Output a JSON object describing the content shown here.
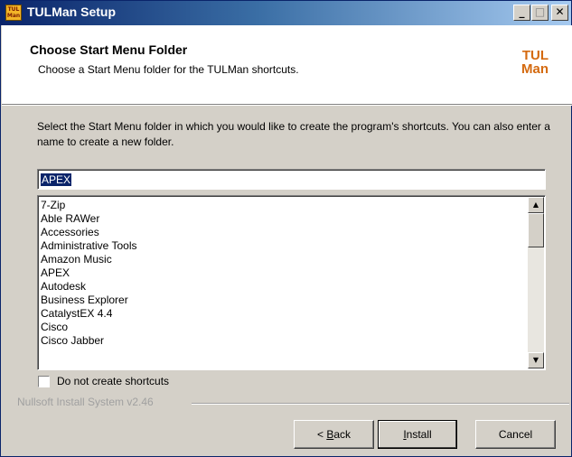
{
  "window": {
    "title": "TULMan Setup",
    "app_icon_text": "TUL Man",
    "controls": {
      "minimize": "_",
      "maximize": "□",
      "close": "✕"
    }
  },
  "header": {
    "title": "Choose Start Menu Folder",
    "subtitle": "Choose a Start Menu folder for the TULMan shortcuts.",
    "logo_line1": "TUL",
    "logo_line2": "Man"
  },
  "body": {
    "description": "Select the Start Menu folder in which you would like to create the program's shortcuts. You can also enter a name to create a new folder.",
    "folder_input_value": "APEX",
    "folders": [
      "7-Zip",
      "Able RAWer",
      "Accessories",
      "Administrative Tools",
      "Amazon Music",
      "APEX",
      "Autodesk",
      "Business Explorer",
      "CatalystEX 4.4",
      "Cisco",
      "Cisco Jabber"
    ],
    "no_shortcuts_label": "Do not create shortcuts",
    "no_shortcuts_checked": false
  },
  "footer": {
    "branding": "Nullsoft Install System v2.46",
    "back_first": "B",
    "back_rest": "ack",
    "back_prefix": "< ",
    "install_first": "I",
    "install_rest": "nstall",
    "cancel_label": "Cancel"
  },
  "colors": {
    "accent": "#0a246a",
    "logo": "#d46a10",
    "dialog_bg": "#d4d0c8"
  }
}
